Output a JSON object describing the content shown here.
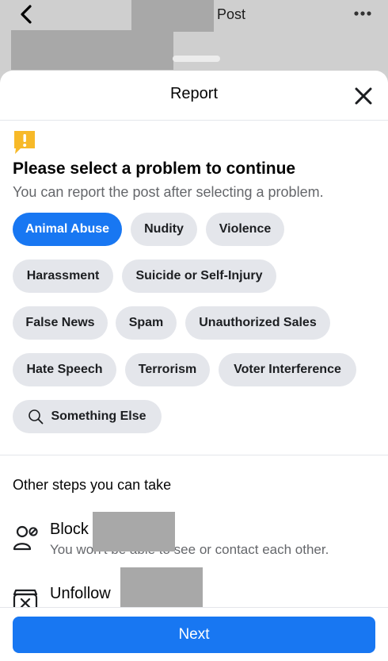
{
  "post_header": {
    "title": "Post",
    "icons": {
      "back": "chevron-left-icon",
      "more": "more-horizontal-icon"
    }
  },
  "sheet": {
    "title": "Report",
    "close_icon": "close-icon"
  },
  "problem": {
    "icon": "alert-icon",
    "heading": "Please select a problem to continue",
    "subheading": "You can report the post after selecting a problem.",
    "selected": "Animal Abuse",
    "options": [
      "Animal Abuse",
      "Nudity",
      "Violence",
      "Harassment",
      "Suicide or Self-Injury",
      "False News",
      "Spam",
      "Unauthorized Sales",
      "Hate Speech",
      "Terrorism",
      "Voter Interference",
      "Something Else"
    ]
  },
  "other_steps": {
    "title": "Other steps you can take",
    "items": [
      {
        "label": "Block",
        "description": "You won't be able to see or contact each other.",
        "icon": "block-user-icon"
      },
      {
        "label": "Unfollow",
        "icon": "unfollow-icon"
      }
    ]
  },
  "footer": {
    "next_label": "Next"
  },
  "colors": {
    "accent": "#1877f2",
    "chip_bg": "#e4e6eb",
    "secondary_text": "#65676b",
    "alert": "#f7b928"
  }
}
